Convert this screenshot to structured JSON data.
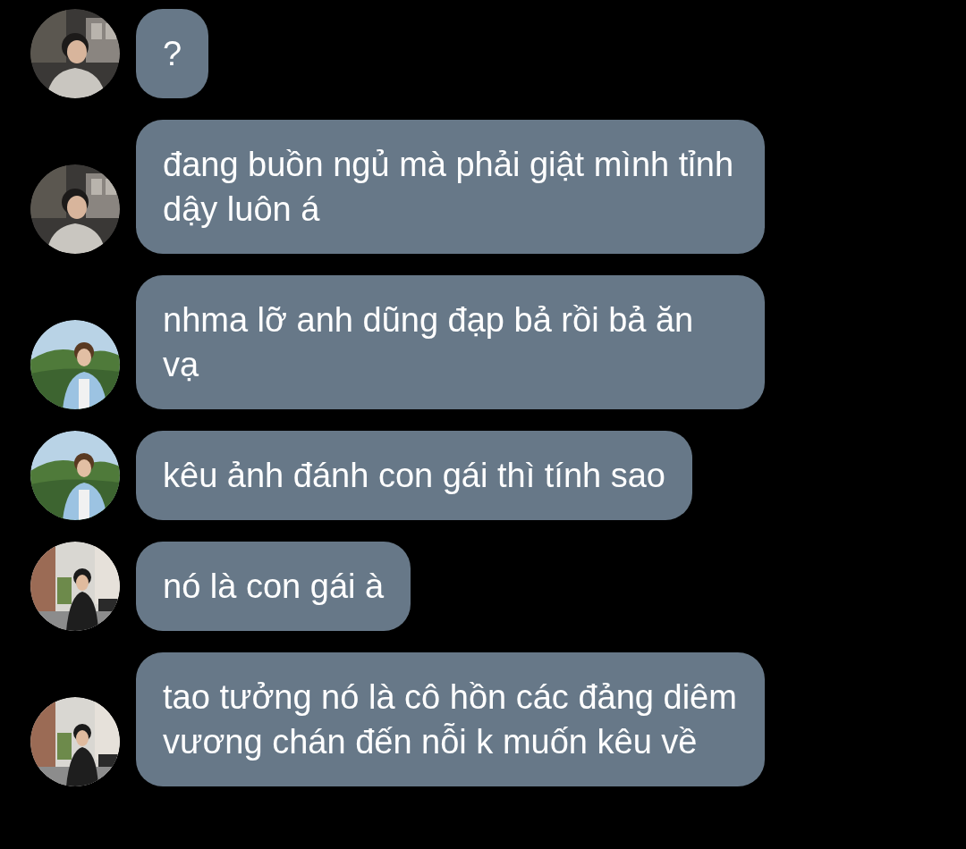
{
  "messages": [
    {
      "text": "?"
    },
    {
      "text": "đang buồn ngủ mà phải giật mình tỉnh dậy luôn á"
    },
    {
      "text": "nhma lỡ anh dũng đạp bả rồi bả ăn vạ"
    },
    {
      "text": "kêu ảnh đánh con gái thì tính sao"
    },
    {
      "text": "nó là con gái à"
    },
    {
      "text": "tao tưởng nó là cô hồn các đảng diêm vương chán đến nỗi k muốn kêu về"
    }
  ]
}
